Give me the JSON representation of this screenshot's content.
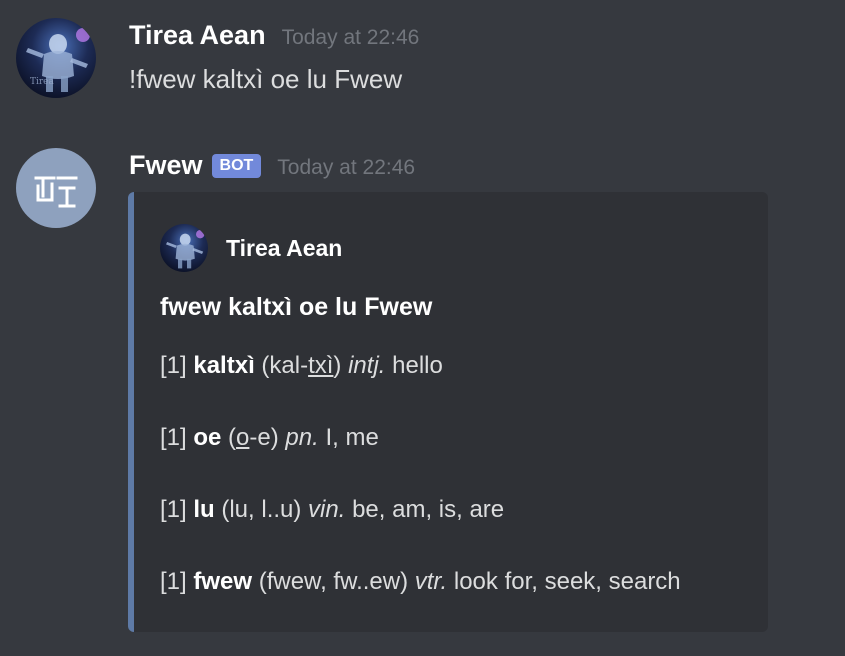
{
  "messages": [
    {
      "author": "Tirea Aean",
      "timestamp": "Today at 22:46",
      "content": "!fwew kaltxì oe lu Fwew",
      "avatar_icon": "astronaut-avatar-icon"
    },
    {
      "author": "Fwew",
      "bot_tag": "BOT",
      "timestamp": "Today at 22:46",
      "avatar_icon": "fwew-logo-icon",
      "avatar_color": "#8ea1be",
      "embed": {
        "accent_color": "#5e7aa6",
        "author_name": "Tirea Aean",
        "title": "fwew kaltxì oe lu Fwew",
        "entries": [
          {
            "index": "[1]",
            "word": "kaltxì",
            "pron_prefix": "(kal-",
            "pron_stressed": "txì",
            "pron_suffix": ")",
            "pos": "intj.",
            "definition": "hello"
          },
          {
            "index": "[1]",
            "word": "oe",
            "pron_prefix": "(",
            "pron_stressed": "o",
            "pron_suffix": "-e)",
            "pos": "pn.",
            "definition": "I, me"
          },
          {
            "index": "[1]",
            "word": "lu",
            "pron_prefix": "(lu, l..u)",
            "pron_stressed": "",
            "pron_suffix": "",
            "pos": "vin.",
            "definition": "be, am, is, are"
          },
          {
            "index": "[1]",
            "word": "fwew",
            "pron_prefix": "(fwew, fw..ew)",
            "pron_stressed": "",
            "pron_suffix": "",
            "pos": "vtr.",
            "definition": "look for, seek, search"
          }
        ]
      }
    }
  ]
}
